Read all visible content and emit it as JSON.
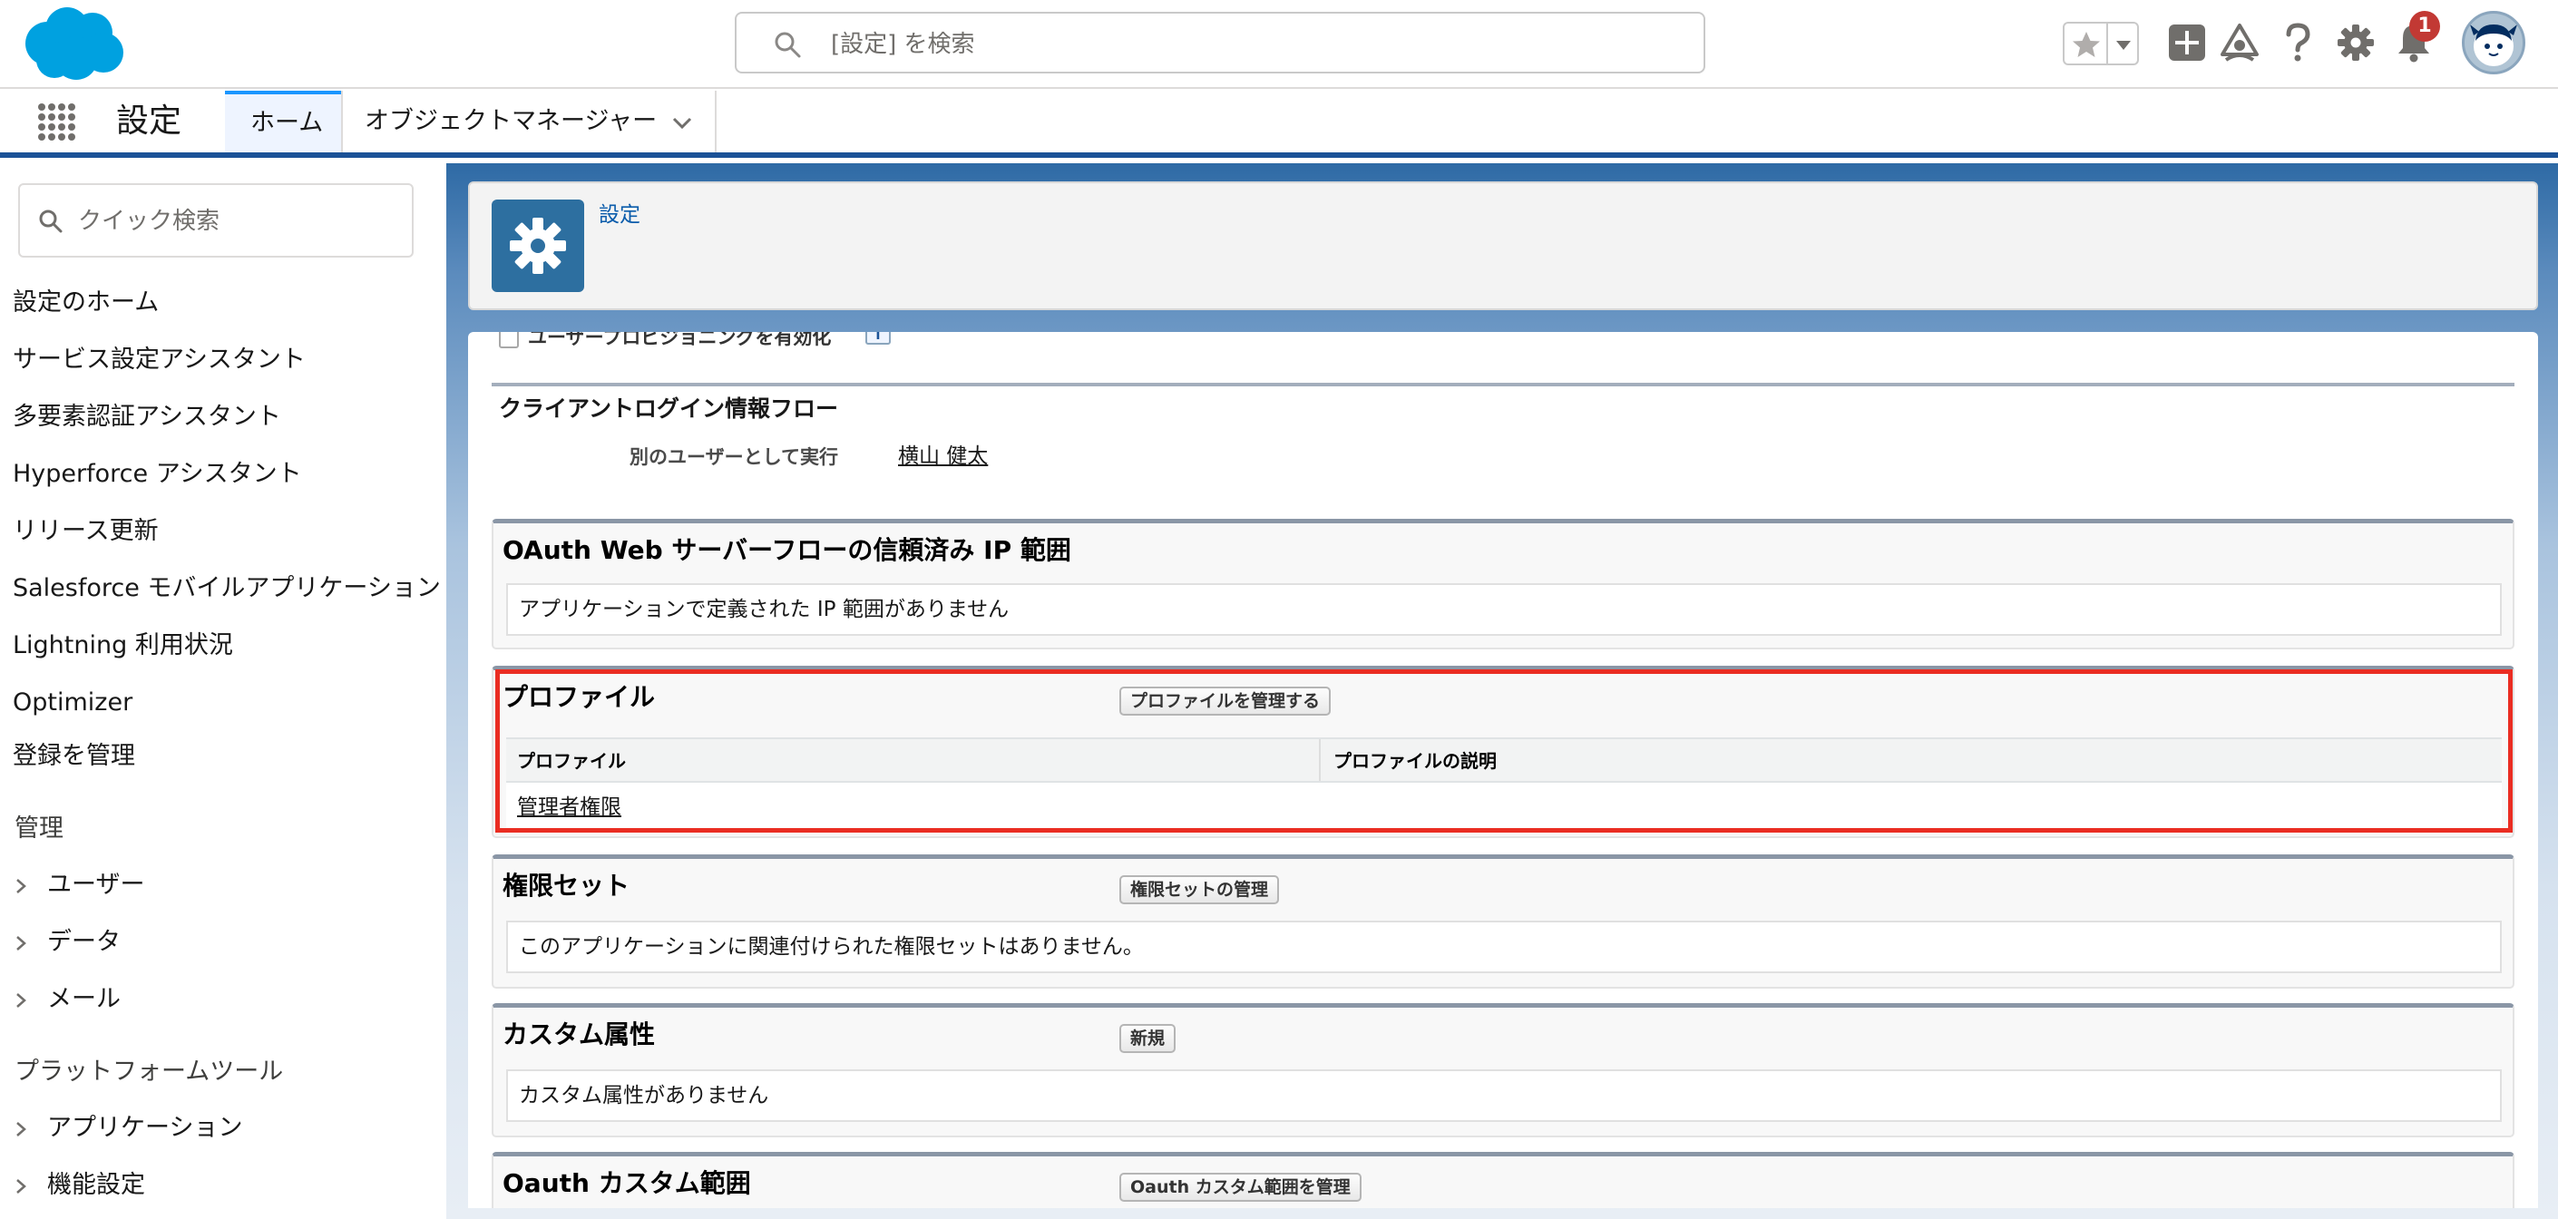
{
  "header": {
    "search_placeholder": "[設定] を検索",
    "notification_count": "1",
    "icons": [
      "salesforce-logo",
      "search-icon",
      "star-icon",
      "dropdown-icon",
      "add-icon",
      "trailhead-icon",
      "help-icon",
      "gear-icon",
      "bell-icon",
      "avatar"
    ]
  },
  "nav": {
    "app_name": "設定",
    "tabs": [
      {
        "label": "ホーム"
      },
      {
        "label": "オブジェクトマネージャー"
      }
    ]
  },
  "sidebar": {
    "quick_find_placeholder": "クイック検索",
    "items": [
      "設定のホーム",
      "サービス設定アシスタント",
      "多要素認証アシスタント",
      "Hyperforce アシスタント",
      "リリース更新",
      "Salesforce モバイルアプリケーション",
      "Lightning 利用状況",
      "Optimizer",
      "登録を管理"
    ],
    "section_admin": "管理",
    "admin_items": [
      "ユーザー",
      "データ",
      "メール"
    ],
    "section_platform": "プラットフォームツール",
    "platform_items": [
      "アプリケーション",
      "機能設定"
    ]
  },
  "page_header": {
    "breadcrumb": "設定"
  },
  "content": {
    "provisioning_label": "ユーザープロビジョニングを有効化",
    "provisioning_help": "i",
    "client_flow": {
      "title": "クライアントログイン情報フロー",
      "run_as_label": "別のユーザーとして実行",
      "run_as_value": "横山 健太"
    },
    "ip_ranges": {
      "title": "OAuth Web サーバーフローの信頼済み IP 範囲",
      "empty": "アプリケーションで定義された IP 範囲がありません"
    },
    "profiles": {
      "title": "プロファイル",
      "button": "プロファイルを管理する",
      "columns": [
        "プロファイル",
        "プロファイルの説明"
      ],
      "rows": [
        {
          "name": "管理者権限",
          "description": ""
        }
      ]
    },
    "permission_sets": {
      "title": "権限セット",
      "button": "権限セットの管理",
      "empty": "このアプリケーションに関連付けられた権限セットはありません。"
    },
    "custom_attributes": {
      "title": "カスタム属性",
      "button": "新規",
      "empty": "カスタム属性がありません"
    },
    "oauth_scopes": {
      "title": "Oauth カスタム範囲",
      "button": "Oauth カスタム範囲を管理"
    }
  },
  "colors": {
    "brand_blue": "#1b5297",
    "logo_blue": "#00a1e0",
    "highlight_red": "#ea2d22",
    "badge_red": "#c23934"
  }
}
